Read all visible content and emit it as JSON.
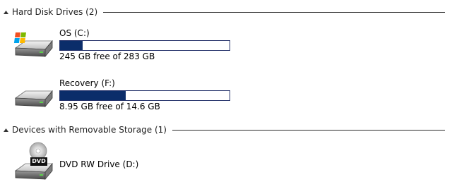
{
  "groups": [
    {
      "label": "Hard Disk Drives (2)",
      "drives": [
        {
          "name": "OS (C:)",
          "icon": "windows-hard-drive-icon",
          "space_text": "245 GB free of 283 GB",
          "used_fraction": 0.134
        },
        {
          "name": "Recovery (F:)",
          "icon": "hard-drive-icon",
          "space_text": "8.95 GB free of 14.6 GB",
          "used_fraction": 0.387
        }
      ]
    },
    {
      "label": "Devices with Removable Storage (1)",
      "drives": [
        {
          "name": "DVD RW Drive (D:)",
          "icon": "dvd-drive-icon",
          "badge": "DVD"
        }
      ]
    }
  ],
  "colors": {
    "bar_fill": "#0b2d6a",
    "bar_border": "#26336b"
  }
}
